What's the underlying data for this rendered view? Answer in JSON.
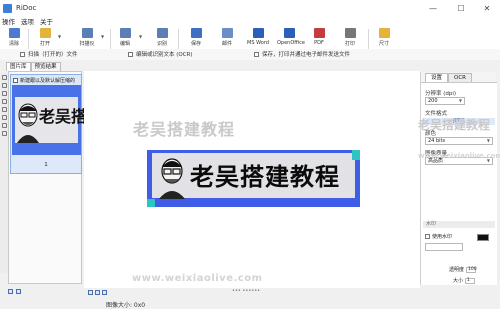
{
  "window": {
    "title": "RiDoc",
    "minimize": "—",
    "maximize": "☐",
    "close": "✕"
  },
  "menu": [
    "操作",
    "选项",
    "关于"
  ],
  "toolbar": {
    "buttons": [
      {
        "label": "清除",
        "icon": "clear-icon",
        "color": "#4a7bd0"
      },
      {
        "label": "打开",
        "icon": "open-folder-icon",
        "color": "#e3b33a"
      },
      {
        "label": "扫描仪",
        "icon": "scanner-icon",
        "color": "#5a7fb5"
      },
      {
        "label": "编辑",
        "icon": "edit-icon",
        "color": "#5a7fb5"
      },
      {
        "label": "识别",
        "icon": "recognize-icon",
        "color": "#5a7fb5"
      },
      {
        "label": "保存",
        "icon": "save-icon",
        "color": "#3d6fc4"
      },
      {
        "label": "邮件",
        "icon": "mail-icon",
        "color": "#6b8cc4"
      },
      {
        "label": "MS Word",
        "icon": "word-icon",
        "color": "#2b5fb8"
      },
      {
        "label": "OpenOffice",
        "icon": "openoffice-icon",
        "color": "#2b5fb8"
      },
      {
        "label": "PDF",
        "icon": "pdf-icon",
        "color": "#c43c3c"
      },
      {
        "label": "打印",
        "icon": "print-icon",
        "color": "#777777"
      },
      {
        "label": "尺寸",
        "icon": "size-icon",
        "color": "#e3b33a"
      }
    ],
    "dropdown_arrow": "▼"
  },
  "cmdbar": [
    "扫描（打开的）文件",
    "编辑或识别文本 (OCR)",
    "保存，打印并通过电子邮件发送文件"
  ],
  "left_panel": {
    "tabs": [
      "图片库",
      "预览结果"
    ],
    "thumb_caption": "新建跟以及默认解压缩的",
    "thumb_text": "老吴搭建",
    "thumb_number": "1"
  },
  "main": {
    "watermark_top": "老吴搭建教程",
    "watermark_bottom": "www.weixiaolive.com",
    "doc_text": "老吴搭建教程",
    "zoom_dots": "••• ••••••",
    "status": "图像大小: 0x0"
  },
  "right_panel": {
    "tabs": [
      "设置",
      "OCR"
    ],
    "watermark": "老吴搭建教程",
    "watermark_url": "www.weixiaolive.com",
    "resolution_label": "分辨率 (dpi)",
    "resolution_value": "200",
    "format_label": "文件格式",
    "format_section": "JPEG",
    "color_label": "颜色",
    "color_value": "24 bits",
    "quality_label": "图像质量",
    "quality_value": "高品质",
    "watermark_section": "水印",
    "use_watermark": "使用水印",
    "opacity_label": "透明度",
    "opacity_value": "100",
    "size_label": "大小",
    "size_value": "1"
  }
}
